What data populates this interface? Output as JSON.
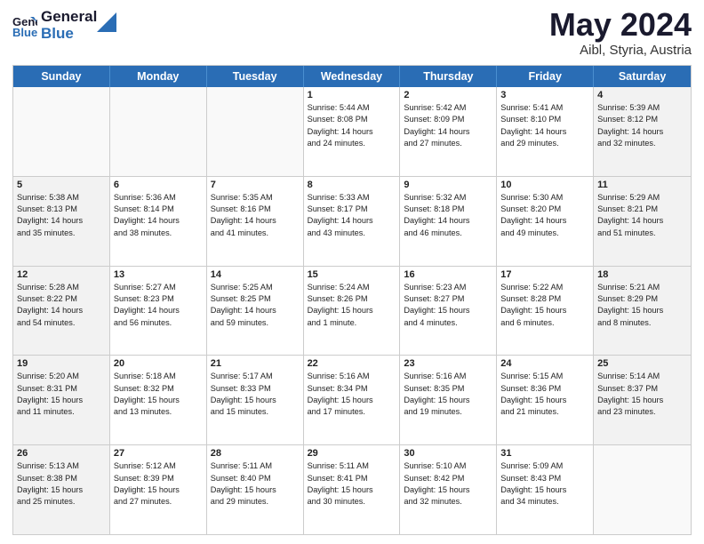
{
  "header": {
    "logo_line1": "General",
    "logo_line2": "Blue",
    "month": "May 2024",
    "location": "Aibl, Styria, Austria"
  },
  "days_of_week": [
    "Sunday",
    "Monday",
    "Tuesday",
    "Wednesday",
    "Thursday",
    "Friday",
    "Saturday"
  ],
  "weeks": [
    [
      {
        "day": "",
        "info": "",
        "empty": true
      },
      {
        "day": "",
        "info": "",
        "empty": true
      },
      {
        "day": "",
        "info": "",
        "empty": true
      },
      {
        "day": "1",
        "info": "Sunrise: 5:44 AM\nSunset: 8:08 PM\nDaylight: 14 hours\nand 24 minutes.",
        "empty": false
      },
      {
        "day": "2",
        "info": "Sunrise: 5:42 AM\nSunset: 8:09 PM\nDaylight: 14 hours\nand 27 minutes.",
        "empty": false
      },
      {
        "day": "3",
        "info": "Sunrise: 5:41 AM\nSunset: 8:10 PM\nDaylight: 14 hours\nand 29 minutes.",
        "empty": false
      },
      {
        "day": "4",
        "info": "Sunrise: 5:39 AM\nSunset: 8:12 PM\nDaylight: 14 hours\nand 32 minutes.",
        "empty": false,
        "shaded": true
      }
    ],
    [
      {
        "day": "5",
        "info": "Sunrise: 5:38 AM\nSunset: 8:13 PM\nDaylight: 14 hours\nand 35 minutes.",
        "empty": false,
        "shaded": true
      },
      {
        "day": "6",
        "info": "Sunrise: 5:36 AM\nSunset: 8:14 PM\nDaylight: 14 hours\nand 38 minutes.",
        "empty": false
      },
      {
        "day": "7",
        "info": "Sunrise: 5:35 AM\nSunset: 8:16 PM\nDaylight: 14 hours\nand 41 minutes.",
        "empty": false
      },
      {
        "day": "8",
        "info": "Sunrise: 5:33 AM\nSunset: 8:17 PM\nDaylight: 14 hours\nand 43 minutes.",
        "empty": false
      },
      {
        "day": "9",
        "info": "Sunrise: 5:32 AM\nSunset: 8:18 PM\nDaylight: 14 hours\nand 46 minutes.",
        "empty": false
      },
      {
        "day": "10",
        "info": "Sunrise: 5:30 AM\nSunset: 8:20 PM\nDaylight: 14 hours\nand 49 minutes.",
        "empty": false
      },
      {
        "day": "11",
        "info": "Sunrise: 5:29 AM\nSunset: 8:21 PM\nDaylight: 14 hours\nand 51 minutes.",
        "empty": false,
        "shaded": true
      }
    ],
    [
      {
        "day": "12",
        "info": "Sunrise: 5:28 AM\nSunset: 8:22 PM\nDaylight: 14 hours\nand 54 minutes.",
        "empty": false,
        "shaded": true
      },
      {
        "day": "13",
        "info": "Sunrise: 5:27 AM\nSunset: 8:23 PM\nDaylight: 14 hours\nand 56 minutes.",
        "empty": false
      },
      {
        "day": "14",
        "info": "Sunrise: 5:25 AM\nSunset: 8:25 PM\nDaylight: 14 hours\nand 59 minutes.",
        "empty": false
      },
      {
        "day": "15",
        "info": "Sunrise: 5:24 AM\nSunset: 8:26 PM\nDaylight: 15 hours\nand 1 minute.",
        "empty": false
      },
      {
        "day": "16",
        "info": "Sunrise: 5:23 AM\nSunset: 8:27 PM\nDaylight: 15 hours\nand 4 minutes.",
        "empty": false
      },
      {
        "day": "17",
        "info": "Sunrise: 5:22 AM\nSunset: 8:28 PM\nDaylight: 15 hours\nand 6 minutes.",
        "empty": false
      },
      {
        "day": "18",
        "info": "Sunrise: 5:21 AM\nSunset: 8:29 PM\nDaylight: 15 hours\nand 8 minutes.",
        "empty": false,
        "shaded": true
      }
    ],
    [
      {
        "day": "19",
        "info": "Sunrise: 5:20 AM\nSunset: 8:31 PM\nDaylight: 15 hours\nand 11 minutes.",
        "empty": false,
        "shaded": true
      },
      {
        "day": "20",
        "info": "Sunrise: 5:18 AM\nSunset: 8:32 PM\nDaylight: 15 hours\nand 13 minutes.",
        "empty": false
      },
      {
        "day": "21",
        "info": "Sunrise: 5:17 AM\nSunset: 8:33 PM\nDaylight: 15 hours\nand 15 minutes.",
        "empty": false
      },
      {
        "day": "22",
        "info": "Sunrise: 5:16 AM\nSunset: 8:34 PM\nDaylight: 15 hours\nand 17 minutes.",
        "empty": false
      },
      {
        "day": "23",
        "info": "Sunrise: 5:16 AM\nSunset: 8:35 PM\nDaylight: 15 hours\nand 19 minutes.",
        "empty": false
      },
      {
        "day": "24",
        "info": "Sunrise: 5:15 AM\nSunset: 8:36 PM\nDaylight: 15 hours\nand 21 minutes.",
        "empty": false
      },
      {
        "day": "25",
        "info": "Sunrise: 5:14 AM\nSunset: 8:37 PM\nDaylight: 15 hours\nand 23 minutes.",
        "empty": false,
        "shaded": true
      }
    ],
    [
      {
        "day": "26",
        "info": "Sunrise: 5:13 AM\nSunset: 8:38 PM\nDaylight: 15 hours\nand 25 minutes.",
        "empty": false,
        "shaded": true
      },
      {
        "day": "27",
        "info": "Sunrise: 5:12 AM\nSunset: 8:39 PM\nDaylight: 15 hours\nand 27 minutes.",
        "empty": false
      },
      {
        "day": "28",
        "info": "Sunrise: 5:11 AM\nSunset: 8:40 PM\nDaylight: 15 hours\nand 29 minutes.",
        "empty": false
      },
      {
        "day": "29",
        "info": "Sunrise: 5:11 AM\nSunset: 8:41 PM\nDaylight: 15 hours\nand 30 minutes.",
        "empty": false
      },
      {
        "day": "30",
        "info": "Sunrise: 5:10 AM\nSunset: 8:42 PM\nDaylight: 15 hours\nand 32 minutes.",
        "empty": false
      },
      {
        "day": "31",
        "info": "Sunrise: 5:09 AM\nSunset: 8:43 PM\nDaylight: 15 hours\nand 34 minutes.",
        "empty": false
      },
      {
        "day": "",
        "info": "",
        "empty": true,
        "shaded": true
      }
    ]
  ]
}
